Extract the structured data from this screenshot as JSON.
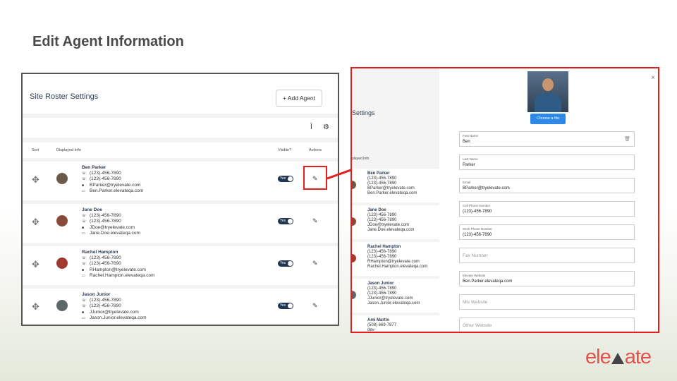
{
  "slide": {
    "title": "Edit Agent Information",
    "brand": {
      "part1": "ele",
      "part2": "ate",
      "color": "#e4504b"
    }
  },
  "roster": {
    "title": "Site Roster Settings",
    "add_agent_label": "+ Add Agent",
    "columns": {
      "sort": "Sort",
      "info": "Displayed Info",
      "visible": "Visible?",
      "actions": "Actions"
    },
    "toggle_label": "Yes",
    "agents": [
      {
        "name": "Ben Parker",
        "phone1": "(123)-456-7890",
        "phone2": "(123)-456-7890",
        "email": "BParker@tryelevate.com",
        "site": "Ben.Parker.elevateqa.com"
      },
      {
        "name": "Jane Doe",
        "phone1": "(123)-456-7890",
        "phone2": "(123)-456-7890",
        "email": "JDoe@tryelevate.com",
        "site": "Jane.Doe.elevateqa.com"
      },
      {
        "name": "Rachel Hampton",
        "phone1": "(123)-456-7890",
        "phone2": "(123)-456-7890",
        "email": "RHampton@tryelevate.com",
        "site": "Rachel.Hampton.elevateqa.com"
      },
      {
        "name": "Jason Junior",
        "phone1": "(123)-456-7890",
        "phone2": "(123)-456-7890",
        "email": "JJunior@tryelevate.com",
        "site": "Jason.Junior.elevateqa.com"
      }
    ]
  },
  "background_list": {
    "title": "Settings",
    "col_info": "played Info",
    "agents": [
      {
        "name": "Ben Parker",
        "phone1": "(123)-456-7890",
        "phone2": "(123)-456-7890",
        "email": "BParker@tryelevate.com",
        "site": "Ben.Parker.elevateqa.com"
      },
      {
        "name": "Jane Doe",
        "phone1": "(123)-456-7890",
        "phone2": "(123)-456-7890",
        "email": "JDoe@tryelevate.com",
        "site": "Jane.Doe.elevateqa.com"
      },
      {
        "name": "Rachel Hampton",
        "phone1": "(123)-456-7890",
        "phone2": "(123)-456-7890",
        "email": "RHampton@tryelevate.com",
        "site": "Rachel.Hampton.elevateqa.com"
      },
      {
        "name": "Jason Junior",
        "phone1": "(123)-456-7890",
        "phone2": "(123)-456-7890",
        "email": "JJunior@tryelevate.com",
        "site": "Jason.Junior.elevateqa.com"
      },
      {
        "name": "Ami Martin",
        "phone1": "(508) 669-7877",
        "phone2": "dev-",
        "email": "",
        "site": ""
      }
    ]
  },
  "edit_modal": {
    "close": "×",
    "choose_file": "Choose a file",
    "fields": [
      {
        "label": "First Name",
        "value": "Ben"
      },
      {
        "label": "Last Name",
        "value": "Parker"
      },
      {
        "label": "Email",
        "value": "BParker@tryelevate.com"
      },
      {
        "label": "Cell Phone Number",
        "value": "(123)-456-7890"
      },
      {
        "label": "Work Phone Number",
        "value": "(123)-456-7890"
      },
      {
        "label": "",
        "placeholder": "Fax Number"
      },
      {
        "label": "Elevate Website",
        "value": "Ben.Parker.elevateqa.com"
      },
      {
        "label": "",
        "placeholder": "Mls Website"
      },
      {
        "label": "",
        "placeholder": "Other Website"
      }
    ]
  },
  "colors": {
    "highlight": "#e51d1d",
    "toggle": "#1f3552",
    "button": "#2d89e5"
  }
}
